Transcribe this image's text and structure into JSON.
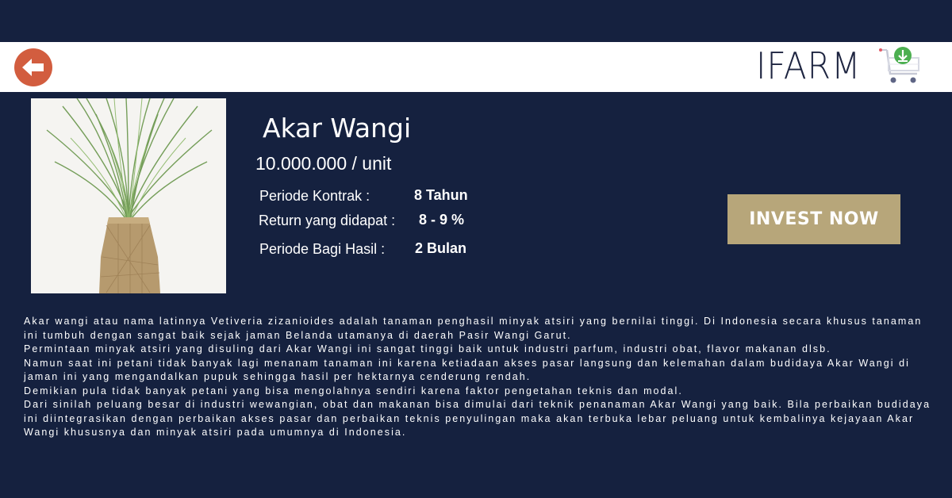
{
  "header": {
    "back_icon": "back-arrow-icon",
    "brand_name": "IFARM",
    "cart_icon": "shopping-cart-download-icon"
  },
  "product": {
    "title": "Akar Wangi",
    "price": "10.000.000 / unit",
    "image": "vetiver-grass-plant-photo",
    "specs": [
      {
        "label": "Periode Kontrak :",
        "value": "8 Tahun"
      },
      {
        "label": "Return yang didapat :",
        "value": "8 - 9 %"
      },
      {
        "label": "Periode Bagi Hasil :",
        "value": "2 Bulan"
      }
    ]
  },
  "cta": {
    "label": "INVEST NOW"
  },
  "description": [
    "Akar wangi atau nama latinnya Vetiveria zizanioides adalah tanaman penghasil minyak atsiri yang bernilai tinggi. Di Indonesia secara khusus tanaman ini tumbuh dengan sangat baik sejak jaman Belanda utamanya di daerah Pasir Wangi Garut.",
    "Permintaan minyak atsiri yang disuling dari Akar Wangi ini sangat tinggi baik untuk industri parfum, industri obat, flavor makanan dlsb.",
    "Namun saat ini petani tidak banyak lagi menanam tanaman ini karena ketiadaan akses pasar langsung dan kelemahan dalam budidaya Akar Wangi di jaman ini yang mengandalkan pupuk sehingga hasil per hektarnya cenderung rendah.",
    "Demikian pula tidak banyak petani yang bisa mengolahnya sendiri karena faktor pengetahan teknis dan modal.",
    "Dari sinilah peluang besar di industri wewangian, obat dan makanan bisa dimulai dari teknik penanaman Akar Wangi yang baik. Bila perbaikan budidaya ini diintegrasikan dengan perbaikan akses pasar dan perbaikan teknis penyulingan maka akan  terbuka lebar peluang untuk kembalinya kejayaan Akar Wangi khususnya dan minyak atsiri pada umumnya di Indonesia."
  ],
  "colors": {
    "background": "#15213f",
    "header": "#ffffff",
    "back_button": "#d25d3f",
    "cta": "#b7a67a",
    "brand_text": "#1d2440",
    "cart_accent": "#4caf50"
  }
}
